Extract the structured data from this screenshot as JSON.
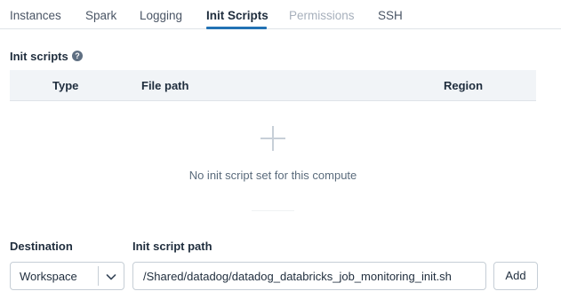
{
  "tabs": {
    "instances": "Instances",
    "spark": "Spark",
    "logging": "Logging",
    "init_scripts": "Init Scripts",
    "permissions": "Permissions",
    "ssh": "SSH",
    "active": "Init Scripts",
    "disabled": [
      "Permissions"
    ]
  },
  "init_scripts": {
    "label": "Init scripts",
    "help_icon": "question-circle-icon",
    "columns": {
      "type": "Type",
      "file_path": "File path",
      "region": "Region"
    },
    "empty_icon": "plus-icon",
    "empty_message": "No init script set for this compute"
  },
  "form": {
    "destination_label": "Destination",
    "destination_value": "Workspace",
    "destination_icon": "chevron-down-icon",
    "path_label": "Init script path",
    "path_value": "/Shared/datadog/datadog_databricks_job_monitoring_init.sh",
    "add_label": "Add"
  },
  "colors": {
    "accent": "#2272b4",
    "header_bg": "#f1f4f7",
    "disabled_text": "#a7b0bc"
  }
}
